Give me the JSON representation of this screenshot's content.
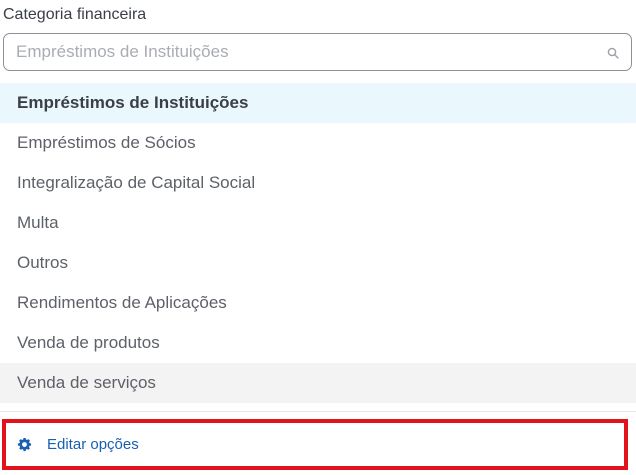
{
  "field": {
    "label": "Categoria financeira",
    "placeholder": "Empréstimos de Instituições",
    "value": ""
  },
  "icons": {
    "search": "search-icon",
    "edit": "gear-icon"
  },
  "colors": {
    "selected_bg": "#eaf7fd",
    "hover_bg": "#f3f3f3",
    "link": "#1a5fb4",
    "highlight_border": "#e3131e"
  },
  "options": [
    {
      "label": "Empréstimos de Instituições",
      "state": "selected"
    },
    {
      "label": "Empréstimos de Sócios",
      "state": "normal"
    },
    {
      "label": "Integralização de Capital Social",
      "state": "normal"
    },
    {
      "label": "Multa",
      "state": "normal"
    },
    {
      "label": "Outros",
      "state": "normal"
    },
    {
      "label": "Rendimentos de Aplicações",
      "state": "normal"
    },
    {
      "label": "Venda de produtos",
      "state": "normal"
    },
    {
      "label": "Venda de serviços",
      "state": "hover"
    }
  ],
  "footer": {
    "edit_label": "Editar opções"
  }
}
